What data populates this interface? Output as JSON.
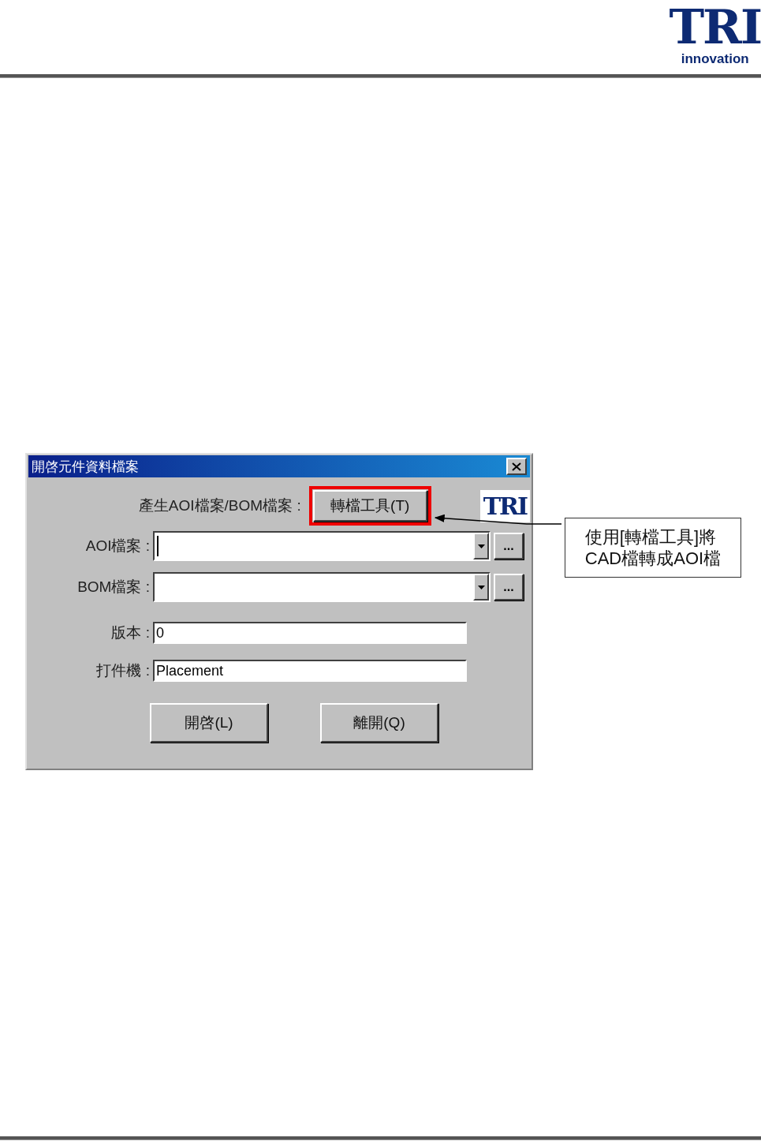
{
  "header": {
    "logo_mark": "TRI",
    "logo_tagline": "innovation"
  },
  "dialog": {
    "title": "開啓元件資料檔案",
    "convert_row": {
      "label": "產生AOI檔案/BOM檔案 :",
      "button": "轉檔工具(T)",
      "highlighted": true
    },
    "logo_mark": "TRI",
    "fields": [
      {
        "kind": "combo",
        "label": "AOI檔案 :",
        "focused": true,
        "browse": "..."
      },
      {
        "kind": "combo",
        "label": "BOM檔案 :",
        "focused": false,
        "browse": "..."
      },
      {
        "kind": "text",
        "label": "版本 :",
        "value": "0"
      },
      {
        "kind": "text",
        "label": "打件機 :",
        "value": "Placement"
      }
    ],
    "buttons": [
      "開啓(L)",
      "離開(Q)"
    ]
  },
  "callout": {
    "lines": [
      "使用[轉檔工具]將",
      "CAD檔轉成AOI檔"
    ]
  }
}
